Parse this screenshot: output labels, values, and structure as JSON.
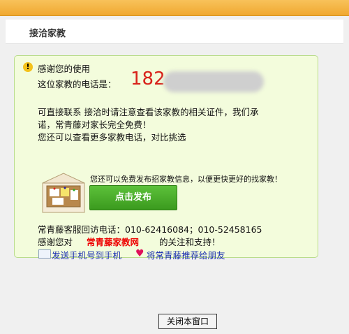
{
  "header": {
    "title": "接洽家教"
  },
  "panel": {
    "thanks": "感谢您的使用",
    "phone_label": "这位家教的电话是：",
    "phone_visible": "182",
    "notice_line1": "可直接联系 接洽时请注意查看该家教的相关证件，我们承",
    "notice_line2": "诺，常青藤对家长完全免费！",
    "notice_line3": "您还可以查看更多家教电话，对比挑选",
    "promo_text": "您还可以免费发布招家教信息，以便更快更好的找家教！",
    "publish_button": "点击发布",
    "service_line": "常青藤客服回访电话：010-62416084；010-52458165",
    "thanks_prefix": "感谢您对",
    "site_name": "常青藤家教网",
    "thanks_suffix": "的关注和支持！",
    "send_link": "发送手机号到手机",
    "recommend_link": "将常青藤推荐给朋友"
  },
  "footer": {
    "close_button": "关闭本窗口"
  },
  "icons": {
    "warning": "warning-icon",
    "mail": "mail-icon",
    "heart": "heart-icon"
  },
  "colors": {
    "accent_orange": "#f0a830",
    "panel_bg": "#f3fcdc",
    "phone_red": "#d8221a",
    "button_green": "#4caf2a",
    "link_blue": "#1a2fb0"
  }
}
